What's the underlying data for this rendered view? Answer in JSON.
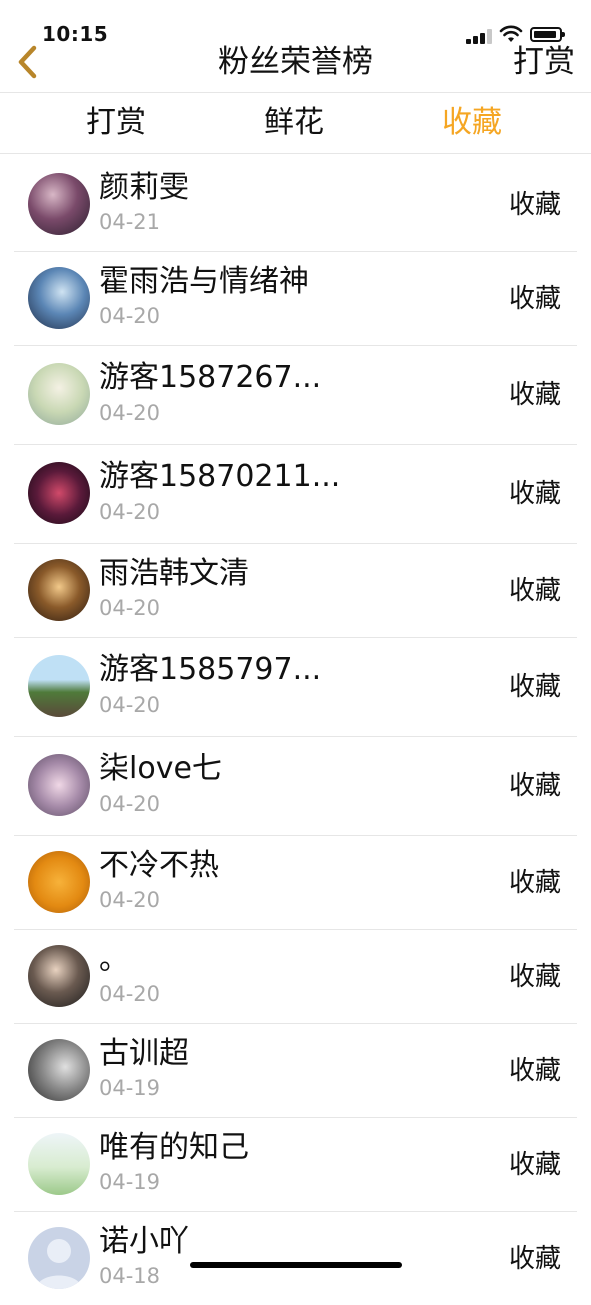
{
  "status_bar": {
    "time": "10:15"
  },
  "nav": {
    "title": "粉丝荣誉榜",
    "right_label": "打赏"
  },
  "tabs": [
    {
      "label": "打赏"
    },
    {
      "label": "鲜花"
    },
    {
      "label": "收藏"
    }
  ],
  "active_tab_color": "#f5a623",
  "rows": [
    {
      "name": "颜莉雯",
      "date": "04-21",
      "action": "收藏"
    },
    {
      "name": "霍雨浩与情绪神",
      "date": "04-20",
      "action": "收藏"
    },
    {
      "name": "游客1587267...",
      "date": "04-20",
      "action": "收藏"
    },
    {
      "name": "游客15870211...",
      "date": "04-20",
      "action": "收藏"
    },
    {
      "name": "雨浩韩文清",
      "date": "04-20",
      "action": "收藏"
    },
    {
      "name": "游客1585797...",
      "date": "04-20",
      "action": "收藏"
    },
    {
      "name": "柒love七",
      "date": "04-20",
      "action": "收藏"
    },
    {
      "name": "不冷不热",
      "date": "04-20",
      "action": "收藏"
    },
    {
      "name": "。",
      "date": "04-20",
      "action": "收藏"
    },
    {
      "name": "古训超",
      "date": "04-19",
      "action": "收藏"
    },
    {
      "name": "唯有的知己",
      "date": "04-19",
      "action": "收藏"
    },
    {
      "name": "诺小吖",
      "date": "04-18",
      "action": "收藏"
    }
  ]
}
